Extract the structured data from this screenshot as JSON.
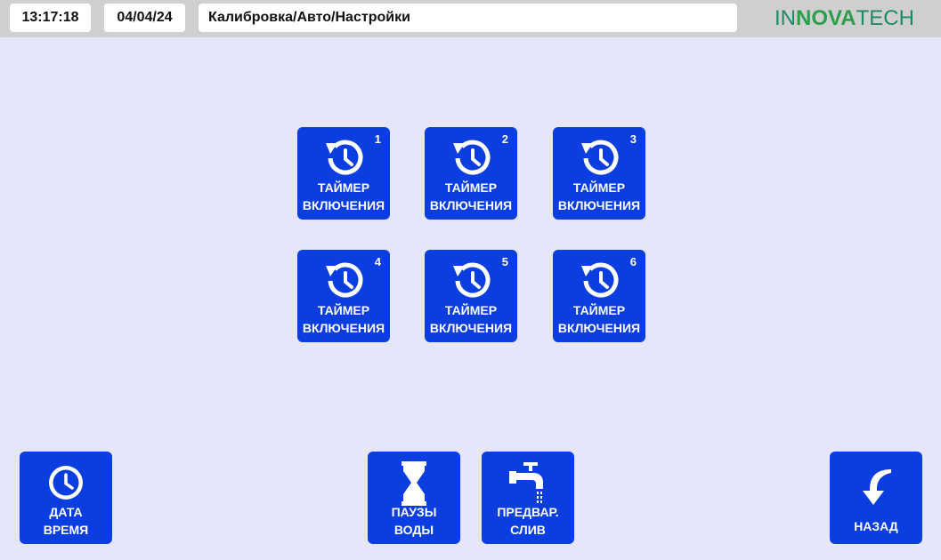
{
  "header": {
    "time": "13:17:18",
    "date": "04/04/24",
    "path": "Калибровка/Авто/Настройки",
    "logo": {
      "part1": "IN",
      "part2": "NOVA",
      "part3": "TECH"
    }
  },
  "timers": [
    {
      "number": "1",
      "line1": "ТАЙМЕР",
      "line2": "ВКЛЮЧЕНИЯ"
    },
    {
      "number": "2",
      "line1": "ТАЙМЕР",
      "line2": "ВКЛЮЧЕНИЯ"
    },
    {
      "number": "3",
      "line1": "ТАЙМЕР",
      "line2": "ВКЛЮЧЕНИЯ"
    },
    {
      "number": "4",
      "line1": "ТАЙМЕР",
      "line2": "ВКЛЮЧЕНИЯ"
    },
    {
      "number": "5",
      "line1": "ТАЙМЕР",
      "line2": "ВКЛЮЧЕНИЯ"
    },
    {
      "number": "6",
      "line1": "ТАЙМЕР",
      "line2": "ВКЛЮЧЕНИЯ"
    }
  ],
  "bottom": {
    "datetime": {
      "line1": "ДАТА",
      "line2": "ВРЕМЯ"
    },
    "water_pauses": {
      "line1": "ПАУЗЫ",
      "line2": "ВОДЫ"
    },
    "pre_drain": {
      "line1": "ПРЕДВАР.",
      "line2": "СЛИВ"
    },
    "back": {
      "label": "НАЗАД"
    }
  },
  "colors": {
    "tile": "#0a3ee0",
    "background": "#e6e6fb",
    "topbar": "#cfcfcf"
  }
}
